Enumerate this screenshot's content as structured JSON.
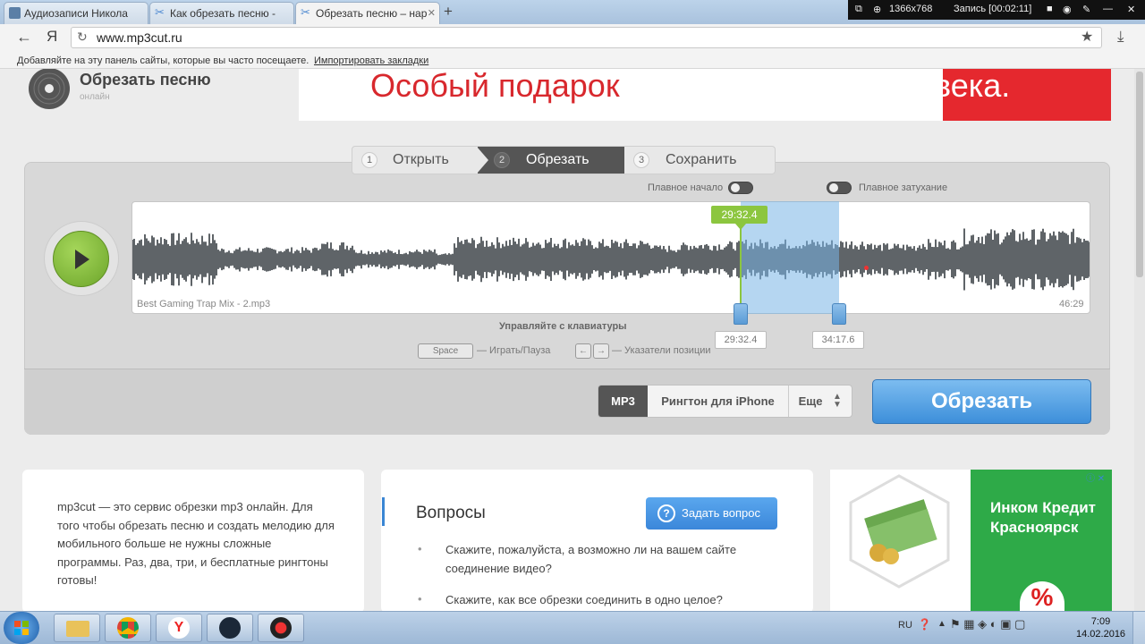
{
  "browser": {
    "tabs": [
      {
        "label": "Аудиозаписи Никола",
        "icon_color": "#5b7fa6"
      },
      {
        "label": "Как обрезать песню -",
        "icon_color": "#4f8ad1"
      },
      {
        "label": "Обрезать песню – нар",
        "icon_color": "#4f8ad1",
        "active": true
      }
    ],
    "new_tab": "+",
    "url": "www.mp3cut.ru",
    "yandex_icon": "Я",
    "bookmarks_hint": "Добавляйте на эту панель сайты, которые вы часто посещаете.",
    "bookmarks_import": "Импортировать закладки"
  },
  "recorder": {
    "resolution": "1366x768",
    "status": "Запись [00:02:11]"
  },
  "site": {
    "title": "Обрезать песню",
    "subtitle": "онлайн",
    "banner_text_left": "Особый подарок",
    "banner_text_right": "для особого человека."
  },
  "steps": [
    {
      "num": "1",
      "label": "Открыть"
    },
    {
      "num": "2",
      "label": "Обрезать",
      "active": true
    },
    {
      "num": "3",
      "label": "Сохранить"
    }
  ],
  "editor": {
    "fade_in_label": "Плавное начало",
    "fade_out_label": "Плавное затухание",
    "file_name": "Best Gaming Trap Mix - 2.mp3",
    "duration": "46:29",
    "marker_current": "29:32.4",
    "start_time": "29:32.4",
    "end_time": "34:17.6",
    "keyboard_title": "Управляйте с клавиатуры",
    "space_key": "Space",
    "space_action": "— Играть/Пауза",
    "arrows_action": "— Указатели позиции",
    "left_arrow": "←",
    "right_arrow": "→",
    "formats": [
      "MP3",
      "Рингтон для iPhone",
      "Еще"
    ],
    "cut_button": "Обрезать",
    "accent_green": "#8cc63f",
    "accent_blue": "#3d8fda"
  },
  "info": {
    "description": "mp3cut — это сервис обрезки mp3 онлайн. Для того чтобы обрезать песню и создать мелодию для мобильного больше не нужны сложные программы. Раз, два, три, и бесплатные рингтоны готовы!",
    "questions_title": "Вопросы",
    "ask_button": "Задать вопрос",
    "questions": [
      "Скажите, пожалуйста, а возможно ли на вашем сайте соединение видео?",
      "Скажите, как все обрезки соединить в одно целое?"
    ]
  },
  "ad": {
    "text": "Инком Кредит Красноярск",
    "badge": "%"
  },
  "taskbar": {
    "lang": "RU",
    "time": "7:09",
    "date": "14.02.2016"
  }
}
